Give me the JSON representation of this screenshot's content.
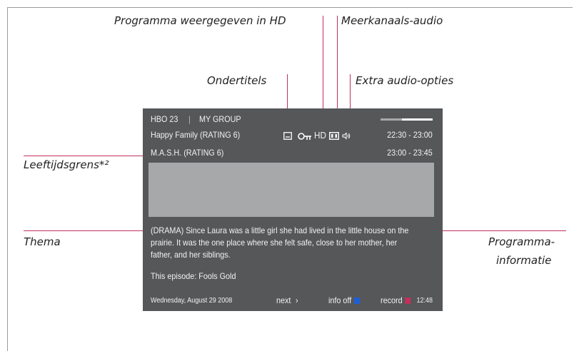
{
  "labels": {
    "hd": "Programma weergegeven in HD",
    "multichannel": "Meerkanaals-audio",
    "subtitles": "Ondertitels",
    "extra_audio": "Extra audio-opties",
    "age_limit": "Leeftijdsgrens*²",
    "theme": "Thema",
    "info_line1": "Programma-",
    "info_line2": "informatie"
  },
  "screen": {
    "channel": "HBO 23",
    "separator": "|",
    "group": "MY GROUP",
    "current_program": "Happy Family (RATING 6)",
    "current_time": "22:30 - 23:00",
    "next_program": "M.A.S.H. (RATING 6)",
    "next_time": "23:00 - 23:45",
    "hd_text": "HD",
    "description_line1": "(DRAMA) Since Laura was a little girl she had lived in the little house on the",
    "description_line2": "prairie. It was the one place where she felt safe, close to her mother, her",
    "description_line3": "father, and her siblings.",
    "episode": "This episode: Fools Gold",
    "date": "Wednesday, August 29 2008",
    "next_label": "next",
    "next_arrow": "›",
    "info_off": "info off",
    "record": "record",
    "clock": "12:48"
  },
  "colors": {
    "accent_line": "#c0305a",
    "screen_bg": "#555759",
    "info_square": "#1f5fd6",
    "record_square": "#c0305a"
  },
  "icons": [
    "subtitle-icon",
    "key-icon",
    "dual-audio-icon",
    "speaker-icon"
  ]
}
